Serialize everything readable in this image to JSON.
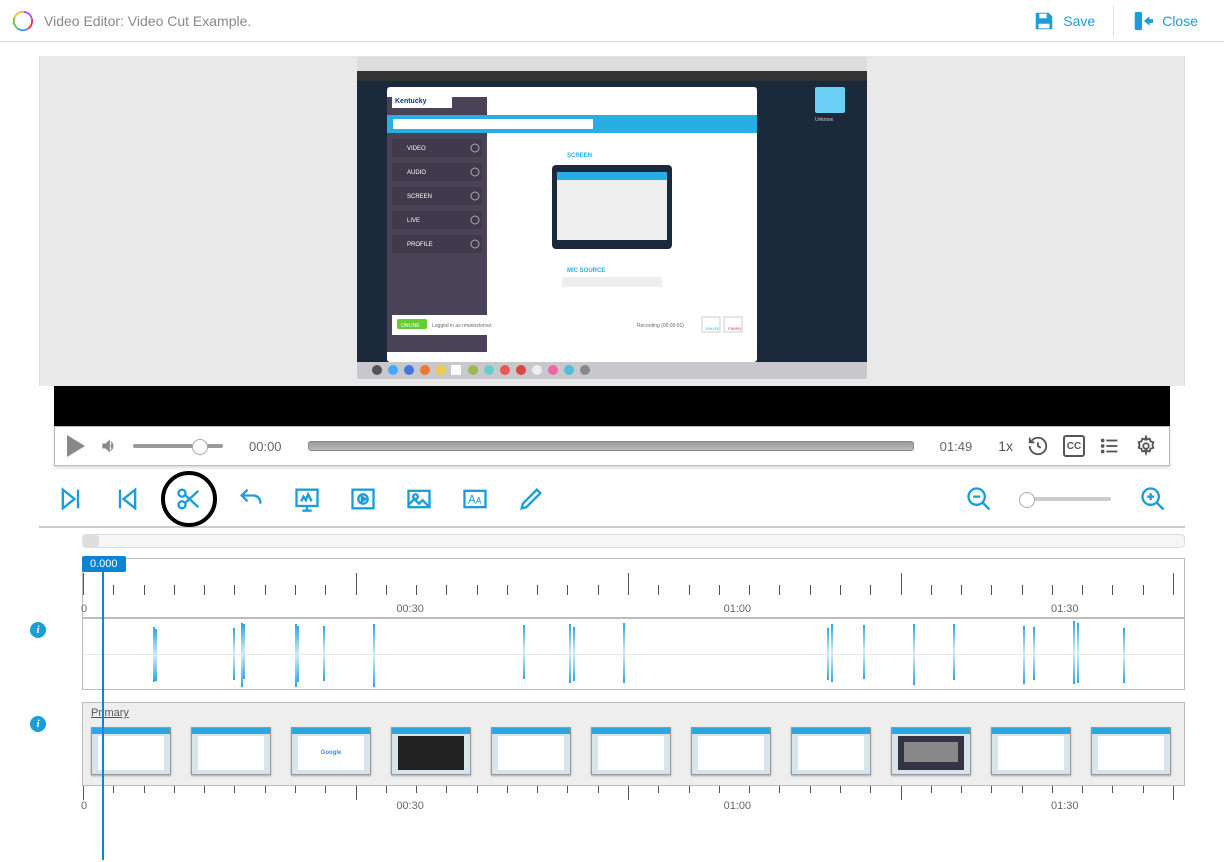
{
  "header": {
    "title": "Video Editor: Video Cut Example.",
    "save_label": "Save",
    "close_label": "Close"
  },
  "player": {
    "current_time": "00:00",
    "duration": "01:49",
    "speed": "1x",
    "cc_label": "CC"
  },
  "playhead": {
    "label": "0.000"
  },
  "ruler_labels": [
    "0",
    "00:30",
    "01:00",
    "01:30"
  ],
  "thumb_track": {
    "label": "Primary"
  },
  "thumb_ruler_labels": [
    "0",
    "00:30",
    "01:00",
    "01:30"
  ]
}
